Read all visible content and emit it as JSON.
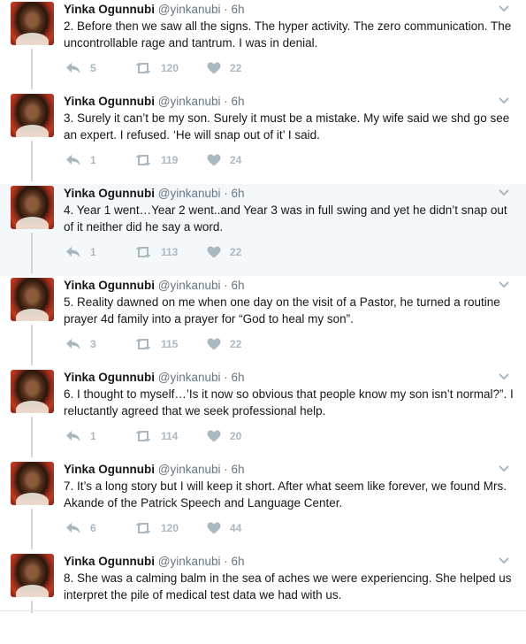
{
  "user": {
    "name": "Yinka Ogunnubi",
    "handle": "@yinkanubi"
  },
  "tweets": [
    {
      "time": "· 6h",
      "text": "2. Before then we saw all the signs. The hyper activity. The zero communication. The uncontrollable rage and tantrum. I was in denial.",
      "replies": "5",
      "retweets": "120",
      "likes": "22",
      "highlighted": false
    },
    {
      "time": "· 6h",
      "text": "3. Surely it can’t be my son. Surely it must be a mistake. My wife said we shd go see an expert. I refused. ‘He will snap out of it’ I said.",
      "replies": "1",
      "retweets": "119",
      "likes": "24",
      "highlighted": false
    },
    {
      "time": "· 6h",
      "text": "4. Year 1 went…Year 2 went..and Year 3 was in full swing and yet he didn’t snap out of it neither did he say a word.",
      "replies": "1",
      "retweets": "113",
      "likes": "22",
      "highlighted": true
    },
    {
      "time": "· 6h",
      "text": "5. Reality dawned on me when one day on the visit of a Pastor, he turned a routine prayer 4d family into a prayer for “God to heal my son”.",
      "replies": "3",
      "retweets": "115",
      "likes": "22",
      "highlighted": false
    },
    {
      "time": "· 6h",
      "text": "6. I thought to myself…’Is it now so obvious that people know my son isn’t normal?”. I reluctantly agreed that we seek professional help.",
      "replies": "1",
      "retweets": "114",
      "likes": "20",
      "highlighted": false
    },
    {
      "time": "· 6h",
      "text": "7. It’s a long story but I will keep it short. After what seem like forever, we found Mrs. Akande of the Patrick Speech and Language Center.",
      "replies": "6",
      "retweets": "120",
      "likes": "44",
      "highlighted": false
    },
    {
      "time": "· 6h",
      "text": "8.  She was a calming balm in the sea of aches we were experiencing. She helped us interpret the pile of medical test data we had with us.",
      "replies": "",
      "retweets": "",
      "likes": "",
      "highlighted": false
    }
  ],
  "icons": {
    "reply": "reply-icon",
    "retweet": "retweet-icon",
    "like": "heart-icon",
    "more": "chevron-down-icon"
  }
}
